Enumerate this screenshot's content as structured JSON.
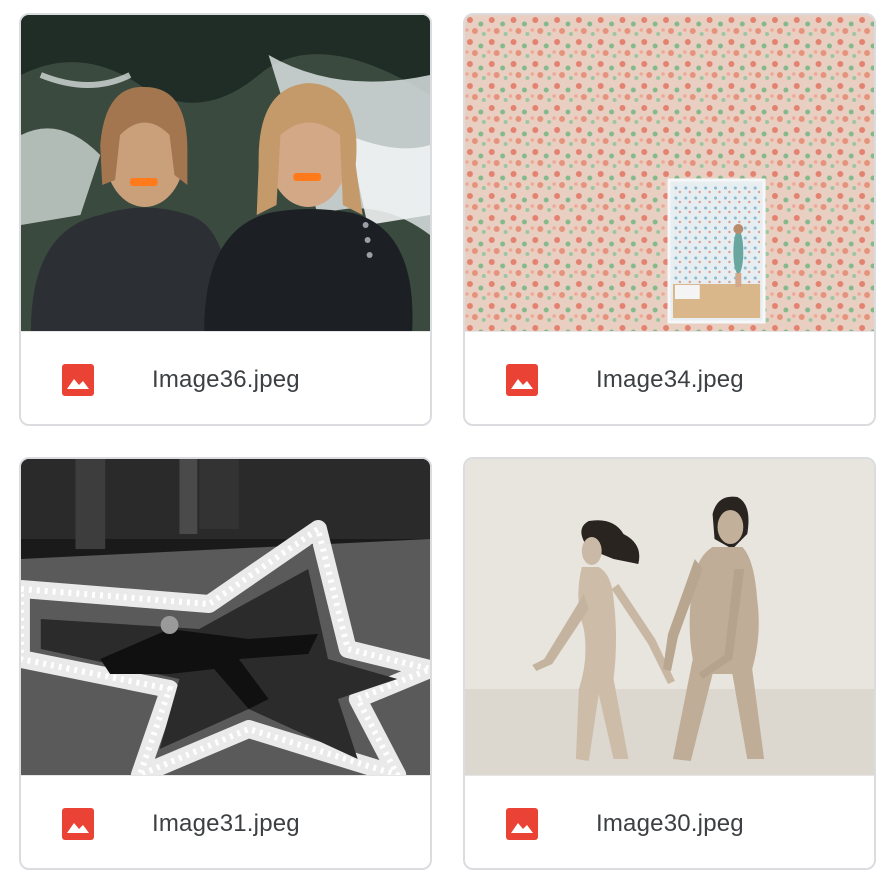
{
  "files": [
    {
      "name": "Image36.jpeg",
      "icon": "image-file-icon"
    },
    {
      "name": "Image34.jpeg",
      "icon": "image-file-icon"
    },
    {
      "name": "Image31.jpeg",
      "icon": "image-file-icon"
    },
    {
      "name": "Image30.jpeg",
      "icon": "image-file-icon"
    }
  ],
  "colors": {
    "icon_red": "#ea4335",
    "border": "#dadce0",
    "text": "#3c4043"
  }
}
